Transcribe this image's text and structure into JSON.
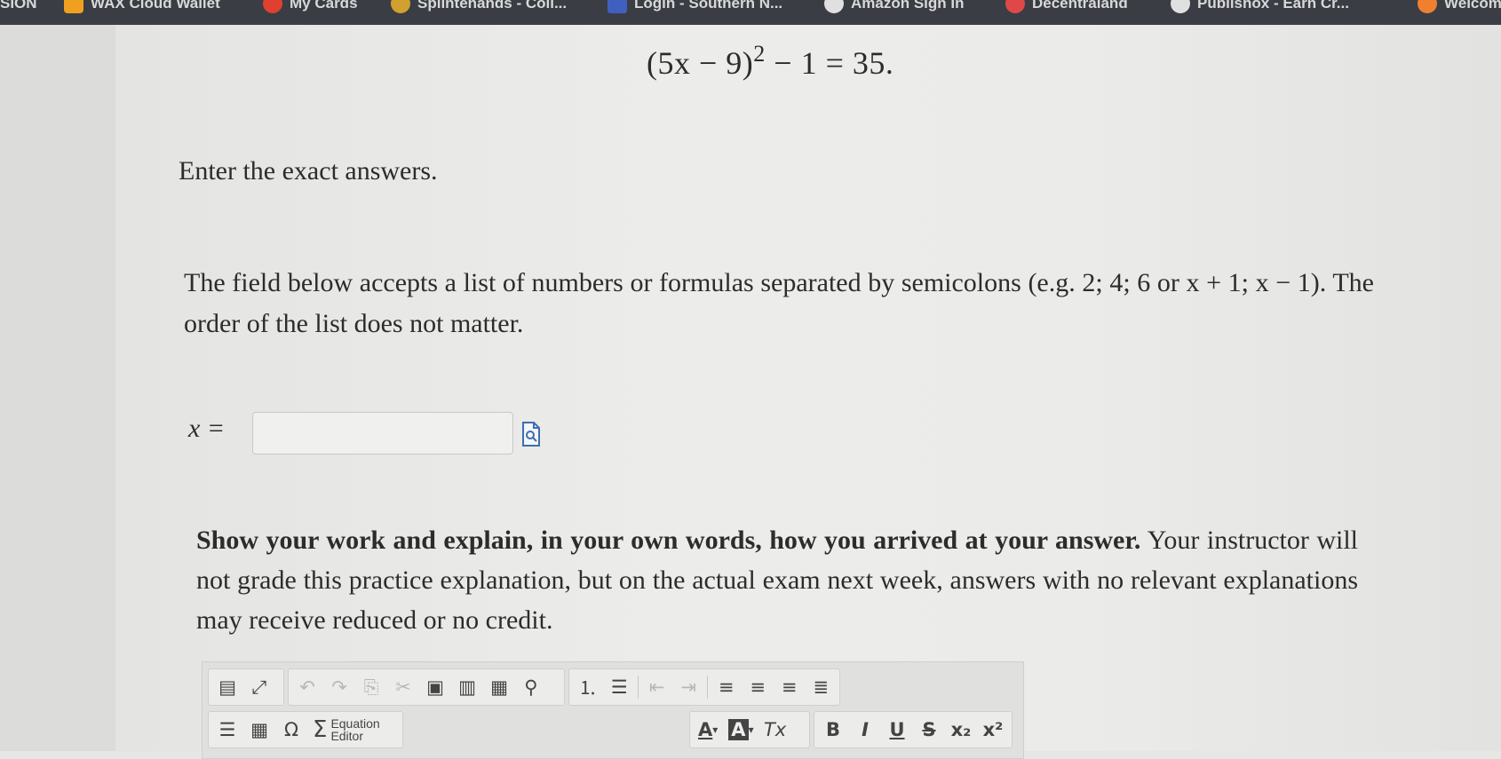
{
  "bookmarks": [
    {
      "label": "SION",
      "icon": "none"
    },
    {
      "label": "WAX Cloud Wallet",
      "icon": "wax-icon",
      "color": "#f0a020"
    },
    {
      "label": "My Cards",
      "icon": "cards-icon",
      "color": "#e04030"
    },
    {
      "label": "Splintehands - Coll...",
      "icon": "splinter-icon",
      "color": "#d0a030"
    },
    {
      "label": "Login - Southern N...",
      "icon": "login-icon",
      "color": "#4060c0"
    },
    {
      "label": "Amazon Sign In",
      "icon": "amazon-icon",
      "color": "#e0e0e0"
    },
    {
      "label": "Decentraland",
      "icon": "decentraland-icon",
      "color": "#e04848"
    },
    {
      "label": "Publishox - Earn Cr...",
      "icon": "publishox-icon",
      "color": "#e0e0e0"
    },
    {
      "label": "Welcom",
      "icon": "welcome-icon",
      "color": "#f08030"
    }
  ],
  "question": {
    "equation_lhs": "(5x − 9)",
    "equation_exp": "2",
    "equation_rhs": " − 1 = 35.",
    "instruction": "Enter the exact answers.",
    "field_note_1": "The field below accepts a list of numbers or formulas separated by semicolons (e.g. 2; 4; 6 or ",
    "field_note_2": "x + 1; x − 1). The order of the list does not matter.",
    "answer_label": "x =",
    "answer_value": "",
    "show_work_bold": "Show your work and explain, in your own words, how you arrived at your answer.",
    "show_work_rest": " Your instructor will not grade this practice explanation, but on the actual exam next week, answers with no relevant explanations may receive reduced or no credit."
  },
  "editor": {
    "equation_editor_line1": "Equation",
    "equation_editor_line2": "Editor",
    "row1": {
      "group1": [
        "document-view-icon",
        "maximize-icon"
      ],
      "group2": [
        "undo-icon",
        "redo-icon",
        "copy-icon",
        "cut-icon",
        "paste-icon",
        "paste-text-icon",
        "paste-word-icon",
        "find-icon"
      ],
      "group3": [
        "numbered-list-icon",
        "bulleted-list-icon",
        "decrease-indent-icon",
        "increase-indent-icon",
        "align-left-icon",
        "align-center-icon",
        "align-right-icon",
        "justify-icon"
      ]
    },
    "row2": {
      "text_color_label": "A",
      "bg_color_label": "A",
      "clear_format_label": "Tx",
      "bold_label": "B",
      "italic_label": "I",
      "underline_label": "U",
      "strike_label": "S",
      "subscript_label": "x₂",
      "superscript_label": "x²",
      "omega_label": "Ω",
      "sigma_label": "Σ"
    }
  }
}
